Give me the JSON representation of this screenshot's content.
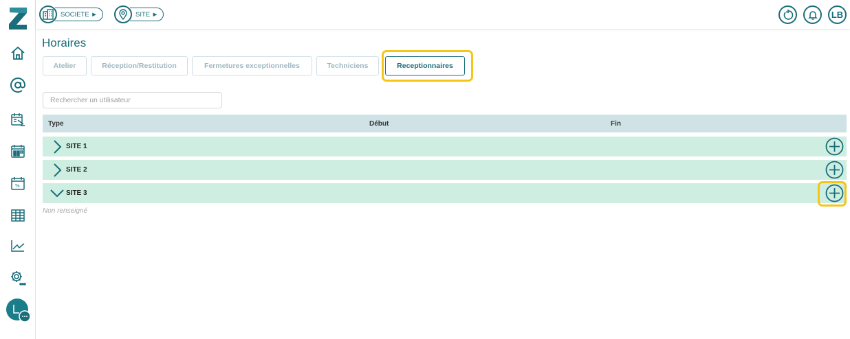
{
  "topbar": {
    "breadcrumbs": [
      {
        "label": "SOCIETE",
        "icon": "building-icon"
      },
      {
        "label": "SITE",
        "icon": "location-pin-icon"
      }
    ],
    "right_icons": [
      "refresh-icon",
      "bell-icon",
      "avatar"
    ],
    "avatar_initials": "LB"
  },
  "sidebar": {
    "items": [
      "home-icon",
      "at-icon",
      "calendar-list-icon",
      "calendar-grid-icon",
      "calendar-percent-icon",
      "table-icon",
      "chart-line-icon",
      "settings-icon",
      "chat-avatar"
    ]
  },
  "page": {
    "title": "Horaires",
    "tabs": [
      {
        "label": "Atelier"
      },
      {
        "label": "Réception/Restitution"
      },
      {
        "label": "Fermetures exceptionnelles"
      },
      {
        "label": "Techniciens"
      },
      {
        "label": "Receptionnaires"
      }
    ],
    "search_placeholder": "Rechercher un utilisateur",
    "columns": [
      "Type",
      "Début",
      "Fin"
    ],
    "sites": [
      {
        "label": "SITE 1",
        "expanded": false
      },
      {
        "label": "SITE 2",
        "expanded": false
      },
      {
        "label": "SITE 3",
        "expanded": true
      }
    ],
    "empty_note": "Non renseigné"
  },
  "colors": {
    "primary": "#1a6d7a",
    "row_bg": "#cdeee0",
    "header_bg": "#cfe3e6",
    "highlight": "#f5c518"
  }
}
